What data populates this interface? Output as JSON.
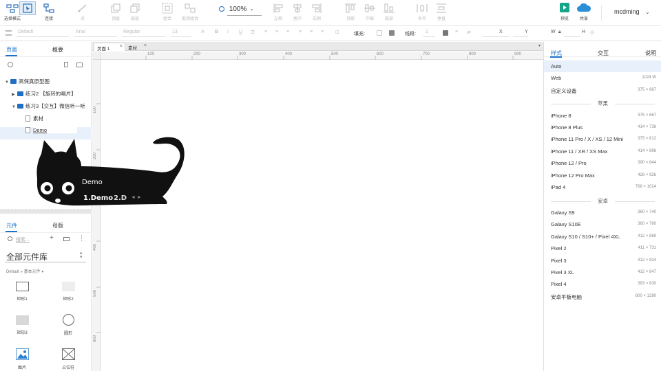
{
  "toolbar": {
    "select_mode": "选择模式",
    "connect": "连接",
    "point": "点",
    "top_layer": "顶层",
    "bottom_layer": "底层",
    "combine": "组合",
    "uncombine": "取消组合",
    "zoom": "100%",
    "align_left": "左侧",
    "align_center": "居中",
    "align_right": "右侧",
    "align_top": "顶部",
    "align_middle": "中部",
    "align_bottom": "底部",
    "horizontal": "水平",
    "vertical": "垂直",
    "preview": "预览",
    "share": "共享",
    "user": "mcdming",
    "accent": "#1a73c8"
  },
  "format": {
    "style": "Default",
    "font": "Arial",
    "weight": "Regular",
    "size": "13",
    "fill_label": "填充:",
    "line_label": "线段:",
    "line_value": "1",
    "x_label": "X",
    "y_label": "Y",
    "w_label": "W",
    "h_label": "H"
  },
  "left": {
    "tab_pages": "页面",
    "tab_outline": "概要",
    "tree": [
      {
        "label": "高保真原型图"
      },
      {
        "label": "练习2 【旋转的唱片】"
      },
      {
        "label": "练习3【交互】微信听一听"
      },
      {
        "label": "素材"
      },
      {
        "label": "Demo"
      }
    ],
    "tab_widgets": "元件",
    "tab_masters": "母版",
    "search_placeholder": "搜索...",
    "library": "全部元件库",
    "library_sub": "Default » 基本元件 ▾",
    "widgets": [
      "矩形1",
      "矩形2",
      "矩形3",
      "圆形",
      "图片",
      "占位符"
    ]
  },
  "canvas": {
    "tabs": [
      "页面 1",
      "素材"
    ],
    "ruler_h": [
      "100",
      "200",
      "300",
      "400",
      "500",
      "600",
      "700",
      "800",
      "900"
    ],
    "ruler_v": [
      "100",
      "200",
      "300",
      "400",
      "500",
      "600"
    ]
  },
  "overlay": {
    "title": "Demo",
    "sub": "1.Demo",
    "ver": "2.D",
    "arrows": "◄ ►"
  },
  "right": {
    "tab_style": "样式",
    "tab_interact": "交互",
    "tab_notes": "说明",
    "devices_top": [
      {
        "name": "Auto",
        "size": ""
      },
      {
        "name": "Web",
        "size": "1024 W"
      },
      {
        "name": "自定义设备",
        "size": "375 × 667"
      }
    ],
    "group_apple": "苹果",
    "apple": [
      {
        "name": "iPhone 8",
        "size": "375 × 667"
      },
      {
        "name": "iPhone 8 Plus",
        "size": "414 × 736"
      },
      {
        "name": "iPhone 11 Pro / X / XS / 12 Mini",
        "size": "375 × 812"
      },
      {
        "name": "iPhone 11 / XR / XS Max",
        "size": "414 × 896"
      },
      {
        "name": "iPhone 12 / Pro",
        "size": "390 × 844"
      },
      {
        "name": "iPhone 12 Pro Max",
        "size": "428 × 926"
      },
      {
        "name": "iPad 4",
        "size": "768 × 1024"
      }
    ],
    "group_android": "安卓",
    "android": [
      {
        "name": "Galaxy S9",
        "size": "360 × 740"
      },
      {
        "name": "Galaxy S10E",
        "size": "360 × 760"
      },
      {
        "name": "Galaxy S10 / S10+ / Pixel 4XL",
        "size": "412 × 869"
      },
      {
        "name": "Pixel 2",
        "size": "411 × 731"
      },
      {
        "name": "Pixel 3",
        "size": "412 × 824"
      },
      {
        "name": "Pixel 3 XL",
        "size": "412 × 847"
      },
      {
        "name": "Pixel 4",
        "size": "393 × 830"
      },
      {
        "name": "安卓平板电脑",
        "size": "800 × 1280"
      }
    ]
  }
}
